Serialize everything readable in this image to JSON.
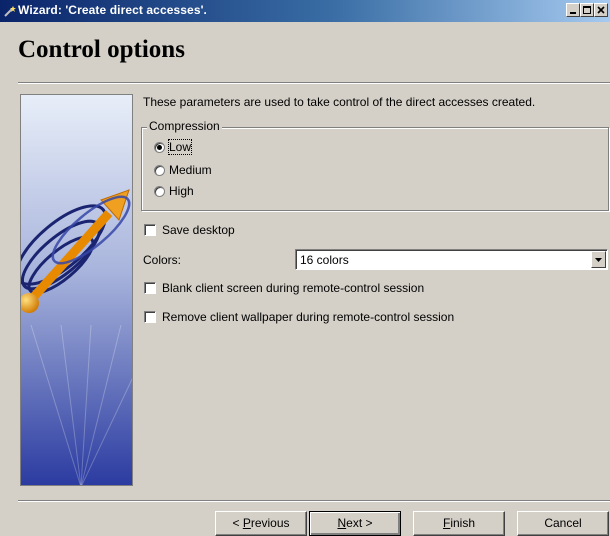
{
  "window": {
    "title": "Wizard: 'Create direct accesses'.",
    "controls": [
      "minimize-icon",
      "maximize-icon",
      "close-icon"
    ]
  },
  "page": {
    "title": "Control options",
    "intro": "These parameters are used to take control of the direct accesses created."
  },
  "compression": {
    "label": "Compression",
    "options": [
      {
        "label": "Low",
        "selected": true
      },
      {
        "label": "Medium",
        "selected": false
      },
      {
        "label": "High",
        "selected": false
      }
    ]
  },
  "save_desktop": {
    "label": "Save desktop",
    "checked": false
  },
  "colors": {
    "label": "Colors:",
    "value": "16 colors"
  },
  "blank_screen": {
    "label": "Blank client screen during remote-control session",
    "checked": false
  },
  "remove_wallpaper": {
    "label": "Remove client wallpaper during remote-control session",
    "checked": false
  },
  "buttons": {
    "previous": {
      "prefix": "< ",
      "mnemonic": "P",
      "rest": "revious"
    },
    "next": {
      "mnemonic": "N",
      "rest": "ext >"
    },
    "finish": {
      "mnemonic": "F",
      "rest": "inish"
    },
    "cancel": "Cancel"
  },
  "colors_theme": {
    "titlebar": "#0a246a",
    "face": "#d4d0c8",
    "accent_arrow": "#f0a020"
  }
}
